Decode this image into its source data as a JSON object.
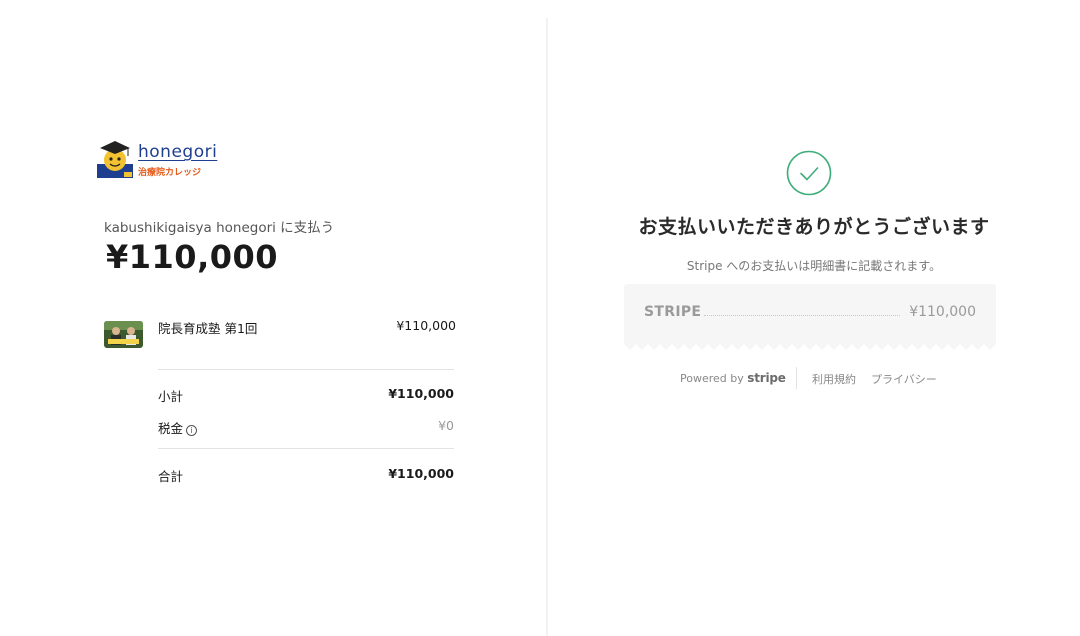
{
  "logo": {
    "wordmark": "honegori",
    "subtitle": "治療院カレッジ",
    "colors": {
      "wordmark": "#1e3f8f",
      "subtitle": "#e45a1a"
    }
  },
  "summary": {
    "merchant_line": "kabushikigaisya honegori に支払う",
    "total_display": "¥110,000",
    "item": {
      "name": "院長育成塾 第1回",
      "price": "¥110,000",
      "thumbnail_icon": "product-thumbnail"
    },
    "subtotal": {
      "label": "小計",
      "value": "¥110,000"
    },
    "tax": {
      "label": "税金",
      "value": "¥0",
      "icon": "info-icon"
    },
    "total": {
      "label": "合計",
      "value": "¥110,000"
    }
  },
  "confirmation": {
    "icon": "check-circle-icon",
    "accent_color": "#3fae7a",
    "title": "お支払いいただきありがとうございます",
    "statement_note": "Stripe へのお支払いは明細書に記載されます。",
    "receipt": {
      "descriptor": "STRIPE",
      "amount": "¥110,000"
    }
  },
  "footer": {
    "powered_by": "Powered by",
    "brand": "stripe",
    "terms": "利用規約",
    "privacy": "プライバシー"
  }
}
